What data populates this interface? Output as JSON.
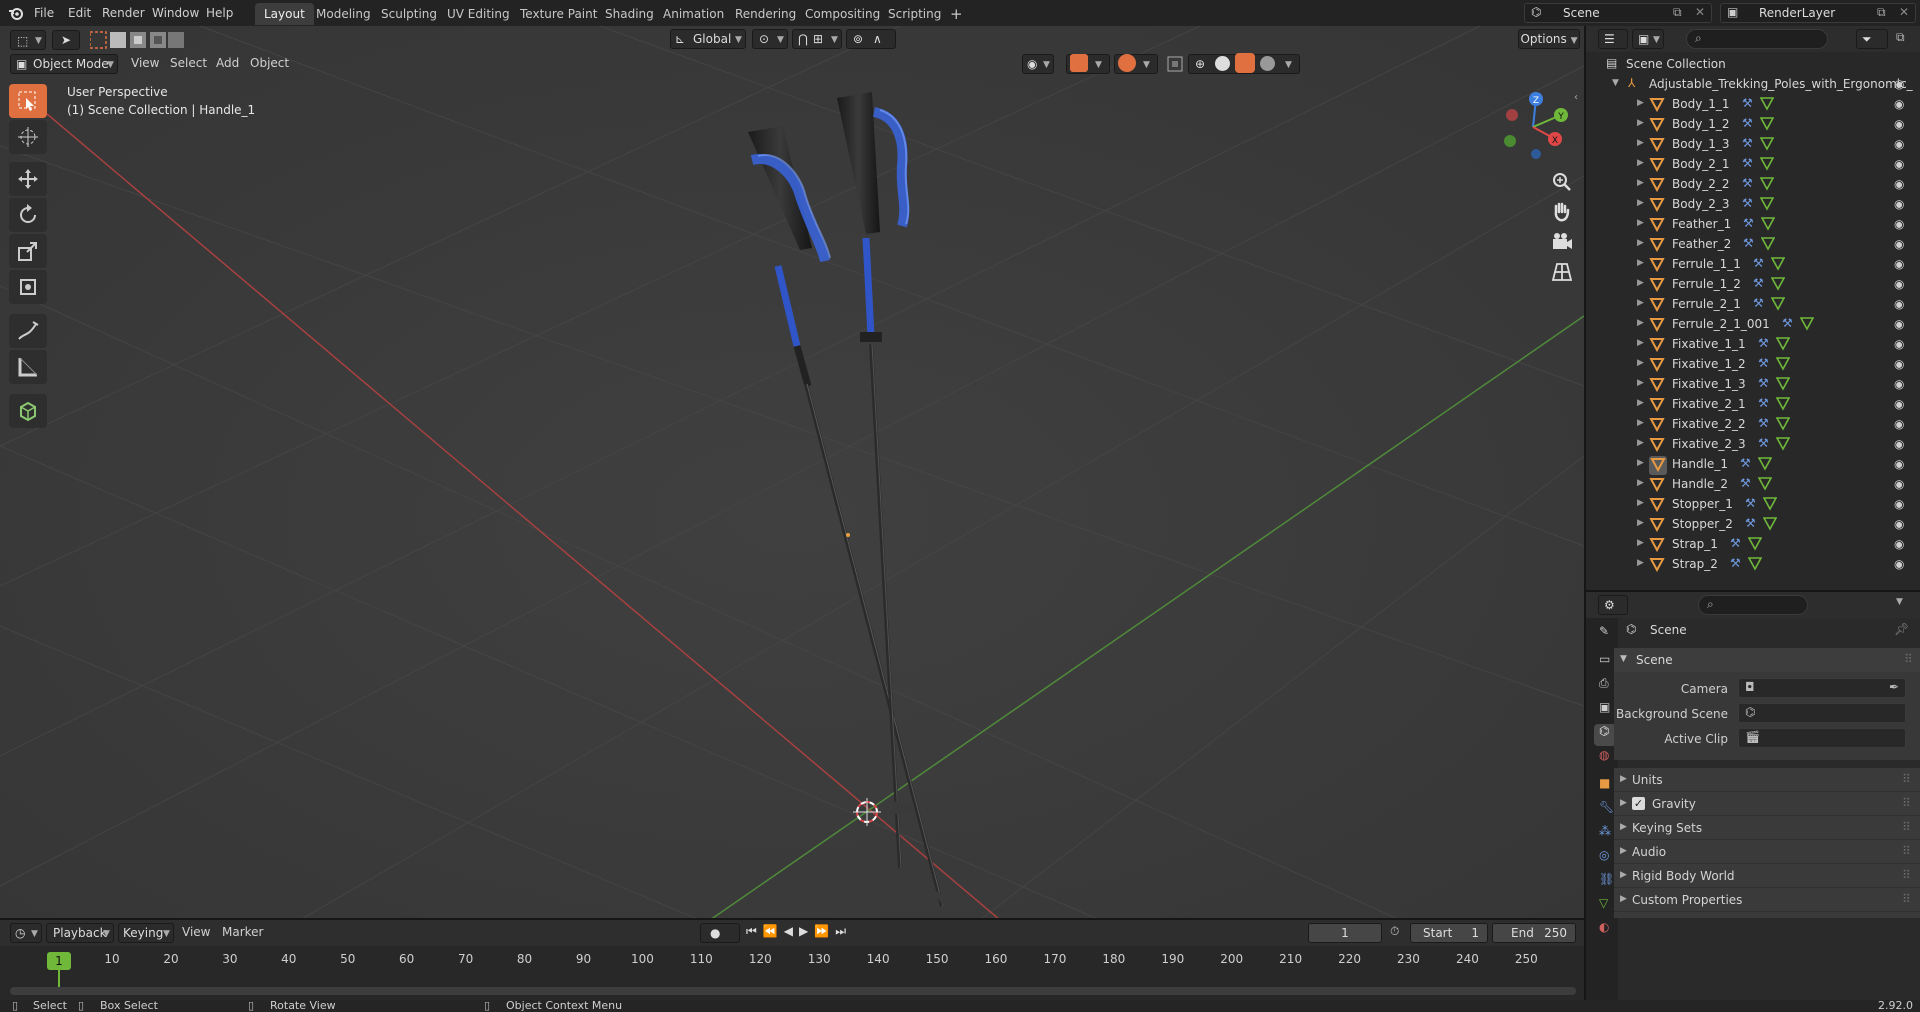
{
  "menu": [
    "File",
    "Edit",
    "Render",
    "Window",
    "Help"
  ],
  "workspaces": [
    "Layout",
    "Modeling",
    "Sculpting",
    "UV Editing",
    "Texture Paint",
    "Shading",
    "Animation",
    "Rendering",
    "Compositing",
    "Scripting"
  ],
  "active_workspace": "Layout",
  "add_workspace_symbol": "+",
  "scene_field": "Scene",
  "view_layer_field": "RenderLayer",
  "viewport": {
    "mode": "Object Mode",
    "menus": [
      "View",
      "Select",
      "Add",
      "Object"
    ],
    "transform_orientation": "Global",
    "options": "Options",
    "info_line1": "User Perspective",
    "info_line2": "(1) Scene Collection | Handle_1",
    "gizmo_axes": {
      "z": "Z",
      "y": "Y",
      "x": "X"
    }
  },
  "outliner": {
    "root": "Scene Collection",
    "collection": "Adjustable_Trekking_Poles_with_Ergonomic_",
    "objects": [
      "Body_1_1",
      "Body_1_2",
      "Body_1_3",
      "Body_2_1",
      "Body_2_2",
      "Body_2_3",
      "Feather_1",
      "Feather_2",
      "Ferrule_1_1",
      "Ferrule_1_2",
      "Ferrule_2_1",
      "Ferrule_2_1_001",
      "Fixative_1_1",
      "Fixative_1_2",
      "Fixative_1_3",
      "Fixative_2_1",
      "Fixative_2_2",
      "Fixative_2_3",
      "Handle_1",
      "Handle_2",
      "Stopper_1",
      "Stopper_2",
      "Strap_1",
      "Strap_2"
    ]
  },
  "properties": {
    "context": "Scene",
    "panel": "Scene",
    "fields": {
      "camera": "Camera",
      "background_scene": "Background Scene",
      "active_clip": "Active Clip"
    },
    "subpanels": [
      "Units",
      "Gravity",
      "Keying Sets",
      "Audio",
      "Rigid Body World",
      "Custom Properties"
    ],
    "gravity_checked": true
  },
  "timeline": {
    "menus": [
      "Playback",
      "Keying",
      "View",
      "Marker"
    ],
    "current_frame": "1",
    "start_label": "Start",
    "start": "1",
    "end_label": "End",
    "end": "250",
    "ticks": [
      "10",
      "20",
      "30",
      "40",
      "50",
      "60",
      "70",
      "80",
      "90",
      "100",
      "110",
      "120",
      "130",
      "140",
      "150",
      "160",
      "170",
      "180",
      "190",
      "200",
      "210",
      "220",
      "230",
      "240",
      "250"
    ],
    "playhead_label": "1"
  },
  "statusbar": {
    "select": "Select",
    "box_select": "Box Select",
    "rotate_view": "Rotate View",
    "context_menu": "Object Context Menu",
    "version": "2.92.0"
  },
  "colors": {
    "accent_selected": "#4a78c8",
    "active_tool": "#e07040",
    "object_icon": "#e89a42",
    "x_axis": "#e04848",
    "y_axis": "#6fb83a",
    "z_axis": "#3d7fe0",
    "pole_grip_blue": "#3a66e0"
  }
}
